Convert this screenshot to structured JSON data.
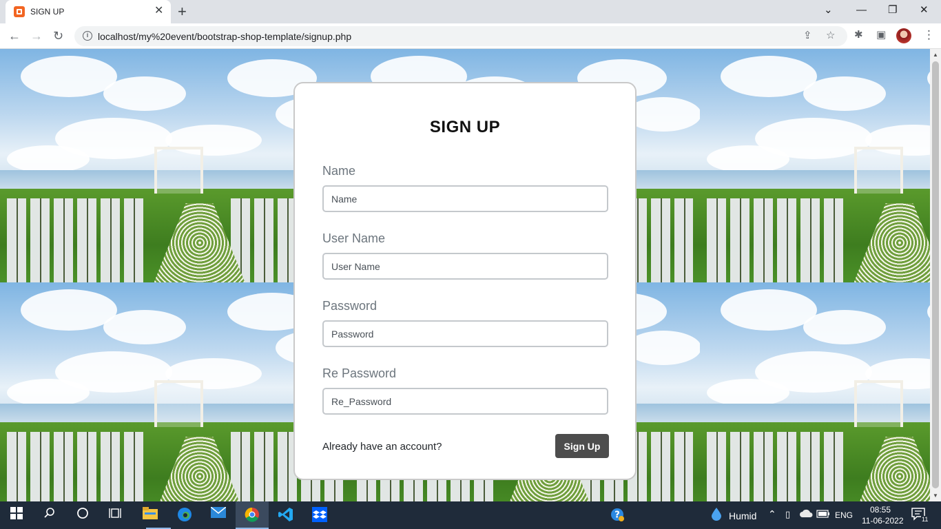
{
  "browser": {
    "tab_title": "SIGN UP",
    "tab_close": "✕",
    "new_tab": "+",
    "url": "localhost/my%20event/bootstrap-shop-template/signup.php",
    "window_controls": {
      "dropdown": "⌄",
      "minimize": "—",
      "restore": "❐",
      "close": "✕"
    },
    "nav": {
      "back": "←",
      "forward": "→",
      "reload": "↻"
    },
    "info_glyph": "i",
    "omnibox_icons": {
      "share": "⇪",
      "bookmark": "☆"
    },
    "toolbar_icons": {
      "extensions": "✱",
      "sidepanel": "▣",
      "menu": "⋮"
    }
  },
  "form": {
    "title": "SIGN UP",
    "fields": [
      {
        "label": "Name",
        "placeholder": "Name"
      },
      {
        "label": "User Name",
        "placeholder": "User Name"
      },
      {
        "label": "Password",
        "placeholder": "Password"
      },
      {
        "label": "Re Password",
        "placeholder": "Re_Password"
      }
    ],
    "account_text": "Already have an account?",
    "submit_label": "Sign Up"
  },
  "taskbar": {
    "weather": "Humid",
    "language": "ENG",
    "time": "08:55",
    "date": "11-06-2022",
    "notification_count": "11"
  },
  "colors": {
    "button_bg": "#4d4d4d",
    "label_color": "#6c757d",
    "taskbar_bg": "#1f2b3a"
  }
}
